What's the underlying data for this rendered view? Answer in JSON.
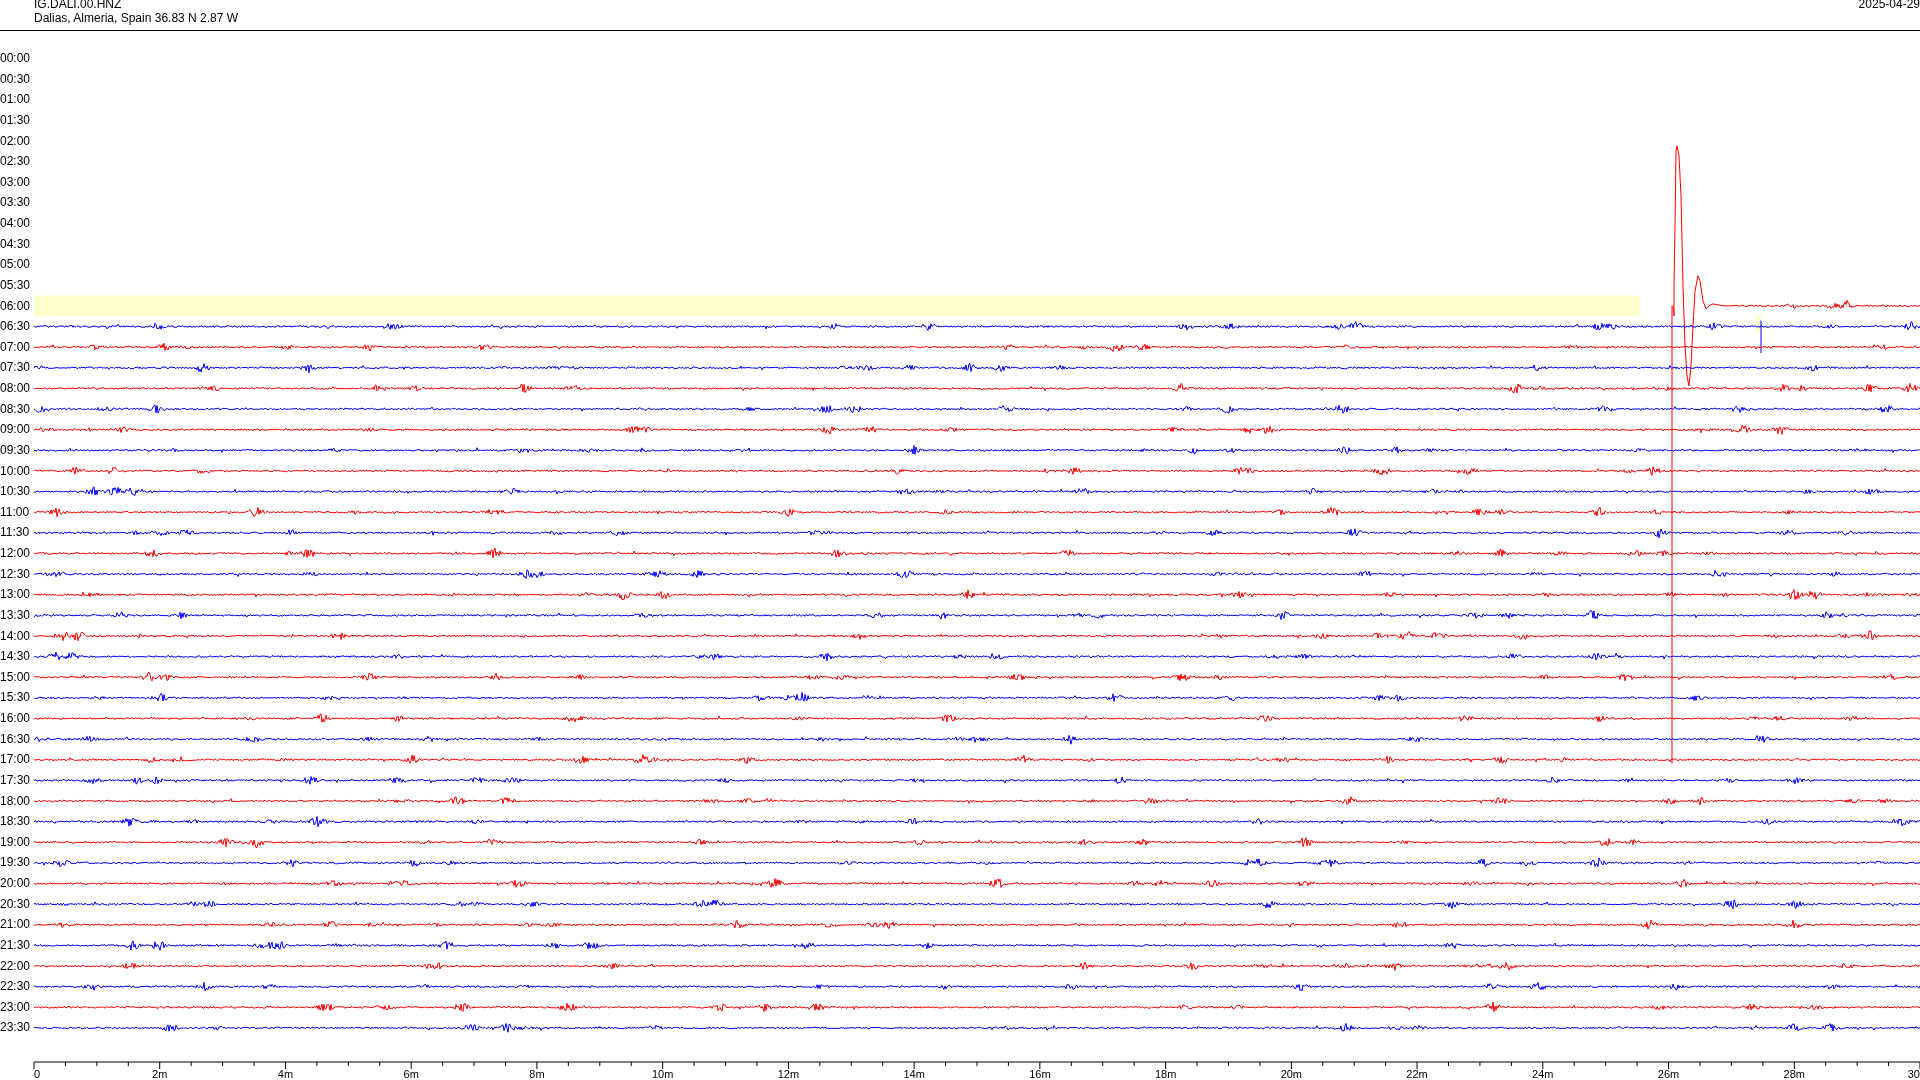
{
  "header": {
    "station": "IG.DALI.00.HNZ",
    "location": "Dalias, Almeria, Spain  36.83 N 2.87 W",
    "date": "2025-04-29"
  },
  "rows": [
    {
      "label": "00:00",
      "kind": "empty",
      "marker": false
    },
    {
      "label": "00:30",
      "kind": "empty",
      "marker": false
    },
    {
      "label": "01:00",
      "kind": "empty",
      "marker": false
    },
    {
      "label": "01:30",
      "kind": "empty",
      "marker": false
    },
    {
      "label": "02:00",
      "kind": "empty",
      "marker": false
    },
    {
      "label": "02:30",
      "kind": "empty",
      "marker": false
    },
    {
      "label": "03:00",
      "kind": "empty",
      "marker": false
    },
    {
      "label": "03:30",
      "kind": "empty",
      "marker": false
    },
    {
      "label": "04:00",
      "kind": "empty",
      "marker": false
    },
    {
      "label": "04:30",
      "kind": "empty",
      "marker": false
    },
    {
      "label": "05:00",
      "kind": "empty",
      "marker": false
    },
    {
      "label": "05:30",
      "kind": "empty",
      "marker": false
    },
    {
      "label": "06:00",
      "kind": "current",
      "color": "#ff0000",
      "marker": false
    },
    {
      "label": "06:30",
      "kind": "full",
      "color": "#0000ff",
      "marker": true
    },
    {
      "label": "07:00",
      "kind": "full",
      "color": "#ff0000",
      "marker": false
    },
    {
      "label": "07:30",
      "kind": "full",
      "color": "#0000ff",
      "marker": false
    },
    {
      "label": "08:00",
      "kind": "full",
      "color": "#ff0000",
      "marker": false
    },
    {
      "label": "08:30",
      "kind": "full",
      "color": "#0000ff",
      "marker": false
    },
    {
      "label": "09:00",
      "kind": "full",
      "color": "#ff0000",
      "marker": false
    },
    {
      "label": "09:30",
      "kind": "full",
      "color": "#0000ff",
      "marker": false
    },
    {
      "label": "10:00",
      "kind": "full",
      "color": "#ff0000",
      "marker": false
    },
    {
      "label": "10:30",
      "kind": "full",
      "color": "#0000ff",
      "marker": false
    },
    {
      "label": "11:00",
      "kind": "full",
      "color": "#ff0000",
      "marker": false
    },
    {
      "label": "11:30",
      "kind": "full",
      "color": "#0000ff",
      "marker": false
    },
    {
      "label": "12:00",
      "kind": "full",
      "color": "#ff0000",
      "marker": false
    },
    {
      "label": "12:30",
      "kind": "full",
      "color": "#0000ff",
      "marker": false
    },
    {
      "label": "13:00",
      "kind": "full",
      "color": "#ff0000",
      "marker": false
    },
    {
      "label": "13:30",
      "kind": "full",
      "color": "#0000ff",
      "marker": false
    },
    {
      "label": "14:00",
      "kind": "full",
      "color": "#ff0000",
      "marker": false
    },
    {
      "label": "14:30",
      "kind": "full",
      "color": "#0000ff",
      "marker": false
    },
    {
      "label": "15:00",
      "kind": "full",
      "color": "#ff0000",
      "marker": false
    },
    {
      "label": "15:30",
      "kind": "full",
      "color": "#0000ff",
      "marker": false
    },
    {
      "label": "16:00",
      "kind": "full",
      "color": "#ff0000",
      "marker": false
    },
    {
      "label": "16:30",
      "kind": "full",
      "color": "#0000ff",
      "marker": false
    },
    {
      "label": "17:00",
      "kind": "full",
      "color": "#ff0000",
      "marker": false
    },
    {
      "label": "17:30",
      "kind": "full",
      "color": "#0000ff",
      "marker": false
    },
    {
      "label": "18:00",
      "kind": "full",
      "color": "#ff0000",
      "marker": false
    },
    {
      "label": "18:30",
      "kind": "full",
      "color": "#0000ff",
      "marker": false
    },
    {
      "label": "19:00",
      "kind": "full",
      "color": "#ff0000",
      "marker": false
    },
    {
      "label": "19:30",
      "kind": "full",
      "color": "#0000ff",
      "marker": false
    },
    {
      "label": "20:00",
      "kind": "full",
      "color": "#ff0000",
      "marker": false
    },
    {
      "label": "20:30",
      "kind": "full",
      "color": "#0000ff",
      "marker": false
    },
    {
      "label": "21:00",
      "kind": "full",
      "color": "#ff0000",
      "marker": false
    },
    {
      "label": "21:30",
      "kind": "full",
      "color": "#0000ff",
      "marker": false
    },
    {
      "label": "22:00",
      "kind": "full",
      "color": "#ff0000",
      "marker": false
    },
    {
      "label": "22:30",
      "kind": "full",
      "color": "#0000ff",
      "marker": false
    },
    {
      "label": "23:00",
      "kind": "full",
      "color": "#ff0000",
      "marker": false
    },
    {
      "label": "23:30",
      "kind": "full",
      "color": "#0000ff",
      "marker": false
    }
  ],
  "x_axis": {
    "labels": [
      "0",
      "2m",
      "4m",
      "6m",
      "8m",
      "10m",
      "12m",
      "14m",
      "16m",
      "18m",
      "20m",
      "22m",
      "24m",
      "26m",
      "28m",
      "30"
    ]
  }
}
